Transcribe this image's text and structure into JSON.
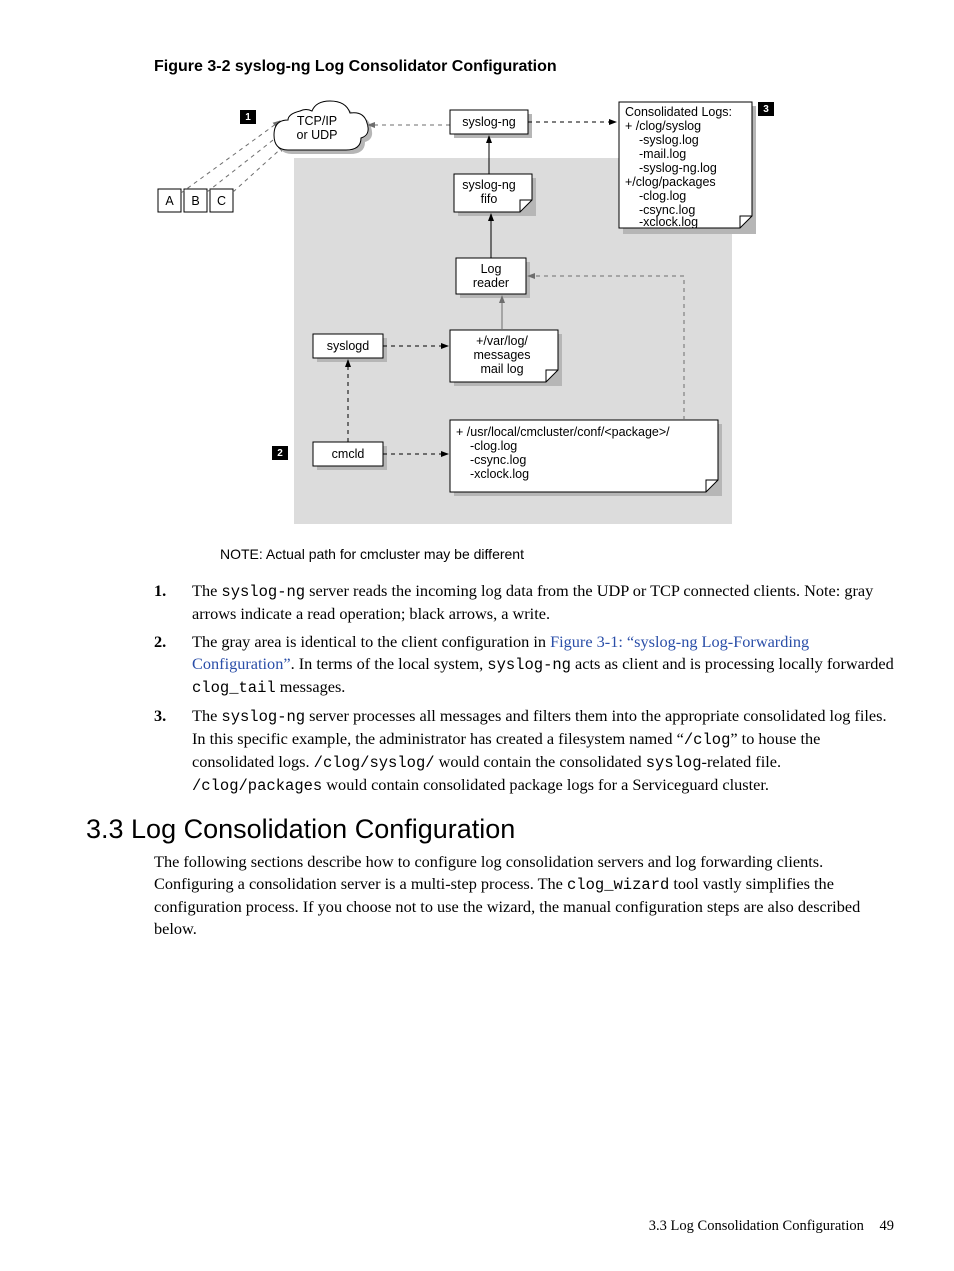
{
  "figure": {
    "caption": "Figure 3-2 syslog-ng Log Consolidator Configuration",
    "nodes": {
      "abc": [
        "A",
        "B",
        "C"
      ],
      "cloud_l1": "TCP/IP",
      "cloud_l2": "or UDP",
      "syslog_ng": "syslog-ng",
      "fifo_l1": "syslog-ng",
      "fifo_l2": "fifo",
      "logreader_l1": "Log",
      "logreader_l2": "reader",
      "syslogd": "syslogd",
      "varlog_l1": "+/var/log/",
      "varlog_l2": "messages",
      "varlog_l3": "mail log",
      "cmcld": "cmcld",
      "pkg_l1": "+ /usr/local/cmcluster/conf/<package>/",
      "pkg_l2": "-clog.log",
      "pkg_l3": "-csync.log",
      "pkg_l4": "-xclock.log",
      "cons_l1": "Consolidated Logs:",
      "cons_l2": "+ /clog/syslog",
      "cons_l3": "-syslog.log",
      "cons_l4": "-mail.log",
      "cons_l5": "-syslog-ng.log",
      "cons_l6": "+/clog/packages",
      "cons_l7": "-clog.log",
      "cons_l8": "-csync.log",
      "cons_l9": "-xclock.log"
    },
    "callouts": {
      "c1": "1",
      "c2": "2",
      "c3": "3"
    },
    "note": "NOTE:  Actual path for cmcluster may be different"
  },
  "list": {
    "item1_pre": "The ",
    "item1_code": "syslog-ng",
    "item1_post": " server reads the incoming log data from the UDP or TCP connected clients. Note: gray arrows indicate a read operation; black arrows, a write.",
    "item2_pre": "The gray area is identical to the client configuration in ",
    "item2_link": "Figure 3-1: “syslog-ng Log-Forwarding Configuration”",
    "item2_mid1": ". In terms of the local system, ",
    "item2_code1": "syslog-ng",
    "item2_mid2": " acts as client and is processing locally forwarded ",
    "item2_code2": "clog_tail",
    "item2_post": " messages.",
    "item3_pre": "The ",
    "item3_code1": "syslog-ng",
    "item3_mid1": " server processes all messages and filters them into the appropriate consolidated log files. In this specific example, the administrator has created a filesystem named “",
    "item3_code2": "/clog",
    "item3_mid2": "” to house the consolidated logs. ",
    "item3_code3": "/clog/syslog/",
    "item3_mid3": " would contain the consolidated ",
    "item3_code4": "syslog",
    "item3_mid4": "-related file. ",
    "item3_code5": "/clog/packages",
    "item3_post": " would contain consolidated package logs for a Serviceguard cluster."
  },
  "section": {
    "heading": "3.3 Log Consolidation Configuration",
    "body_pre": "The following sections describe how to configure log consolidation servers and log forwarding clients. Configuring a consolidation server is a multi-step process. The ",
    "body_code": "clog_wizard",
    "body_post": " tool vastly simplifies the configuration process. If you choose not to use the wizard, the manual configuration steps are also described below."
  },
  "footer": {
    "label": "3.3 Log Consolidation Configuration",
    "page": "49"
  }
}
